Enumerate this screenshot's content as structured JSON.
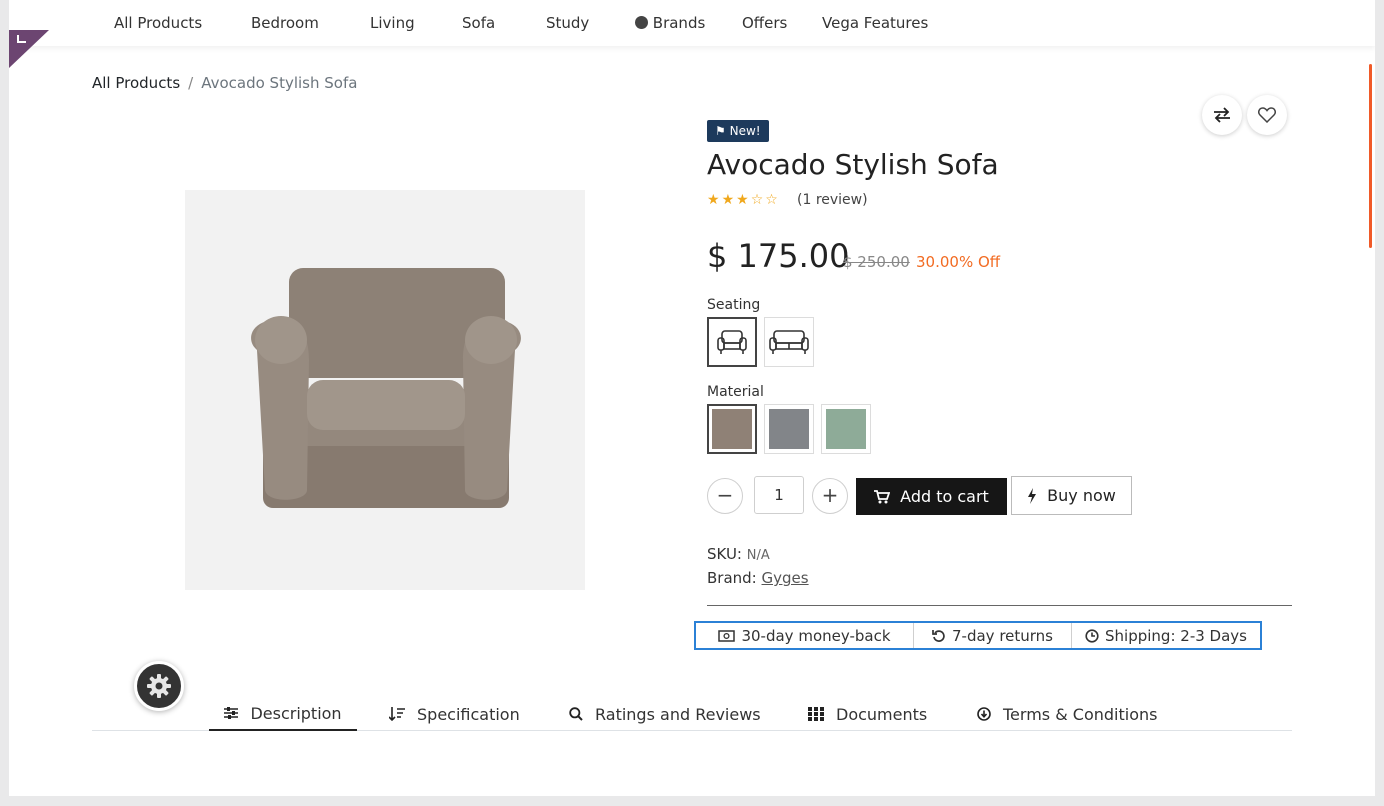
{
  "nav": {
    "items": [
      "All Products",
      "Bedroom",
      "Living",
      "Sofa",
      "Study",
      "Brands",
      "Offers",
      "Vega Features"
    ]
  },
  "breadcrumb": {
    "root": "All Products",
    "separator": "/",
    "current": "Avocado Stylish Sofa"
  },
  "product": {
    "badge": "New!",
    "title": "Avocado Stylish Sofa",
    "rating": 3,
    "rating_max": 5,
    "review_text": "(1 review)",
    "price": "$ 175.00",
    "old_price": "$ 250.00",
    "discount": "30.00% Off",
    "colors": {
      "badge_bg": "#1d3a5c",
      "discount": "#f26b22",
      "stars": "#f0a81d",
      "highlight_border": "#2b81d6"
    }
  },
  "seating": {
    "label": "Seating",
    "options": [
      {
        "icon": "armchair-icon",
        "selected": true
      },
      {
        "icon": "sofa-icon",
        "selected": false
      }
    ]
  },
  "material": {
    "label": "Material",
    "options": [
      {
        "color": "#8f8176",
        "selected": true
      },
      {
        "color": "#828589",
        "selected": false
      },
      {
        "color": "#8eab98",
        "selected": false
      }
    ]
  },
  "cart": {
    "quantity": "1",
    "add_label": "Add to cart",
    "buy_label": "Buy now"
  },
  "meta": {
    "sku_label": "SKU:",
    "sku_value": "N/A",
    "brand_label": "Brand:",
    "brand_value": "Gyges"
  },
  "promises": [
    {
      "icon": "money-icon",
      "text": "30-day money-back"
    },
    {
      "icon": "undo-icon",
      "text": "7-day returns"
    },
    {
      "icon": "clock-icon",
      "text": "Shipping: 2-3 Days"
    }
  ],
  "tabs": [
    {
      "icon": "sliders-icon",
      "label": "Description",
      "active": true
    },
    {
      "icon": "sort-icon",
      "label": "Specification",
      "active": false
    },
    {
      "icon": "search-icon",
      "label": "Ratings and Reviews",
      "active": false
    },
    {
      "icon": "grid-icon",
      "label": "Documents",
      "active": false
    },
    {
      "icon": "arrow-circle-down-icon",
      "label": "Terms & Conditions",
      "active": false
    }
  ]
}
